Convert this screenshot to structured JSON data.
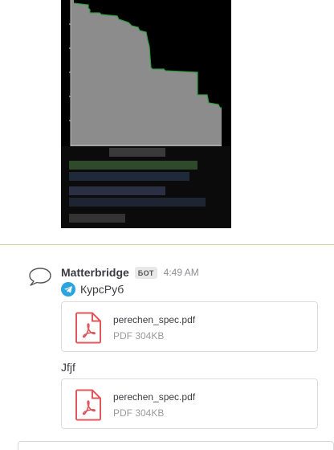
{
  "message": {
    "username": "Matterbridge",
    "badge": "БОТ",
    "time": "4:49 AM",
    "source_icon": "telegram-icon",
    "source_name": "КурсРуб",
    "text": "Jfjf"
  },
  "attachments": [
    {
      "name": "perechen_spec.pdf",
      "meta": "PDF 304KB",
      "icon": "pdf-file-icon"
    },
    {
      "name": "perechen_spec.pdf",
      "meta": "PDF 304KB",
      "icon": "pdf-file-icon"
    }
  ],
  "colors": {
    "divider": "#c8d59a",
    "pdf_red": "#e0565d",
    "telegram_blue": "#2aa3df",
    "chart_fill": "#8c8c8c",
    "chart_edge": "#2ea043"
  }
}
